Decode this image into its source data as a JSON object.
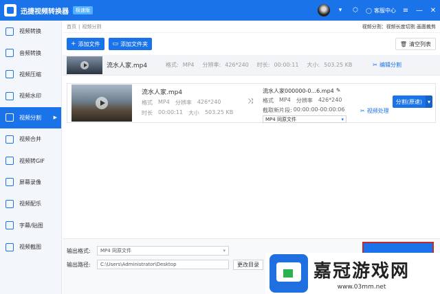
{
  "app": {
    "title": "迅捷视频转换器",
    "edition": "极速版"
  },
  "titlebar": {
    "user_center": "客服中心",
    "minimize": "—",
    "close": "✕"
  },
  "sidebar": {
    "items": [
      {
        "label": "视频转换"
      },
      {
        "label": "音频转换"
      },
      {
        "label": "视频压缩"
      },
      {
        "label": "视频水印"
      },
      {
        "label": "视频分割",
        "active": true
      },
      {
        "label": "视频合并"
      },
      {
        "label": "视频转GIF"
      },
      {
        "label": "屏幕录像"
      },
      {
        "label": "视频配乐"
      },
      {
        "label": "字幕/贴图"
      },
      {
        "label": "视频截图"
      }
    ]
  },
  "breadcrumb": {
    "home": "首页",
    "sep": "|",
    "current": "视频分割",
    "right": "视频分割：视频长度切割 画面裁剪"
  },
  "toolbar": {
    "add_file": "添加文件",
    "add_folder": "添加文件夹",
    "clear_list": "清空列表"
  },
  "file_row": {
    "name": "流水人家.mp4",
    "format_label": "格式:",
    "format": "MP4",
    "resolution_label": "分辨率:",
    "resolution": "426*240",
    "duration_label": "时长:",
    "duration": "00:00:11",
    "size_label": "大小:",
    "size": "503.25 KB",
    "edit_split": "编辑分割"
  },
  "detail": {
    "source": {
      "name": "流水人家.mp4",
      "format_label": "格式",
      "format": "MP4",
      "resolution_label": "分辨率",
      "resolution": "426*240",
      "duration_label": "时长",
      "duration": "00:00:11",
      "size_label": "大小",
      "size": "503.25 KB"
    },
    "output": {
      "name": "流水人家000000-0...6.mp4",
      "format_label": "格式",
      "format": "MP4",
      "resolution_label": "分辨率",
      "resolution": "426*240",
      "clip_label": "截取新片段:",
      "clip_range": "00:00:00-00:00:06",
      "select_value": "MP4  同原文件"
    },
    "process": "视频处理",
    "split_button": "分割(原速)"
  },
  "bottom": {
    "format_label": "输出格式:",
    "format_value": "MP4  同原文件",
    "path_label": "输出路径:",
    "path_value": "C:\\Users\\Administrator\\Desktop",
    "change_dir": "更改目录"
  },
  "watermark": {
    "chars": "嘉冠游戏网",
    "url": "www.03mm.net"
  }
}
